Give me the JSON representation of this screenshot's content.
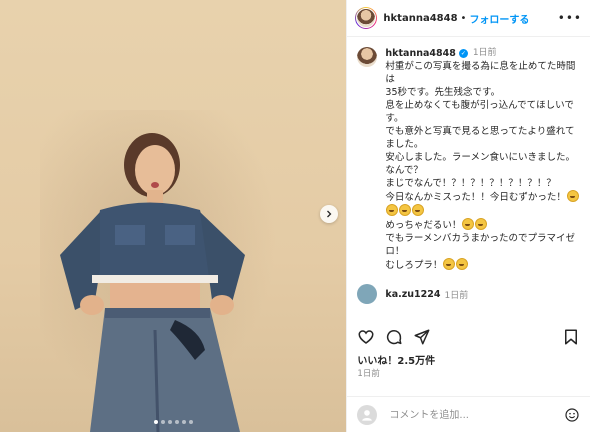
{
  "header": {
    "username": "hktanna4848",
    "separator": "•",
    "follow_label": "フォローする",
    "more_label": "•••"
  },
  "caption": {
    "username": "hktanna4848",
    "time": "1日前",
    "lines": [
      "村重がこの写真を撮る為に息を止めてた時間は",
      "35秒です。先生残念です。",
      "息を止めなくても腹が引っ込んでてほしいです。",
      "でも意外と写真で見ると思ってたより盛れてました。",
      "安心しました。ラーメン食いにいきました。なんで？",
      "まじでなんで！？！？！？！？！？！？",
      "今日なんかミスった！！今日むずかった！",
      "めっちゃだるい！",
      "でもラーメンバカうまかったのでプラマイゼロ！",
      "むしろプラ！"
    ]
  },
  "comment2": {
    "username": "ka.zu1224",
    "time": "1日前"
  },
  "likes": "いいね！2.5万件",
  "date": "1日前",
  "comment_input": {
    "placeholder": "コメントを追加..."
  },
  "icons": {
    "like": "heart-icon",
    "comment": "comment-bubble-icon",
    "share": "paper-plane-icon",
    "save": "bookmark-icon",
    "emoji": "smiley-icon",
    "next": "chevron-right-icon"
  },
  "carousel": {
    "count": 6,
    "active": 0
  },
  "colors": {
    "accent": "#0095f6",
    "text": "#262626",
    "muted": "#8e8e8e",
    "background": "#e6cea8"
  }
}
